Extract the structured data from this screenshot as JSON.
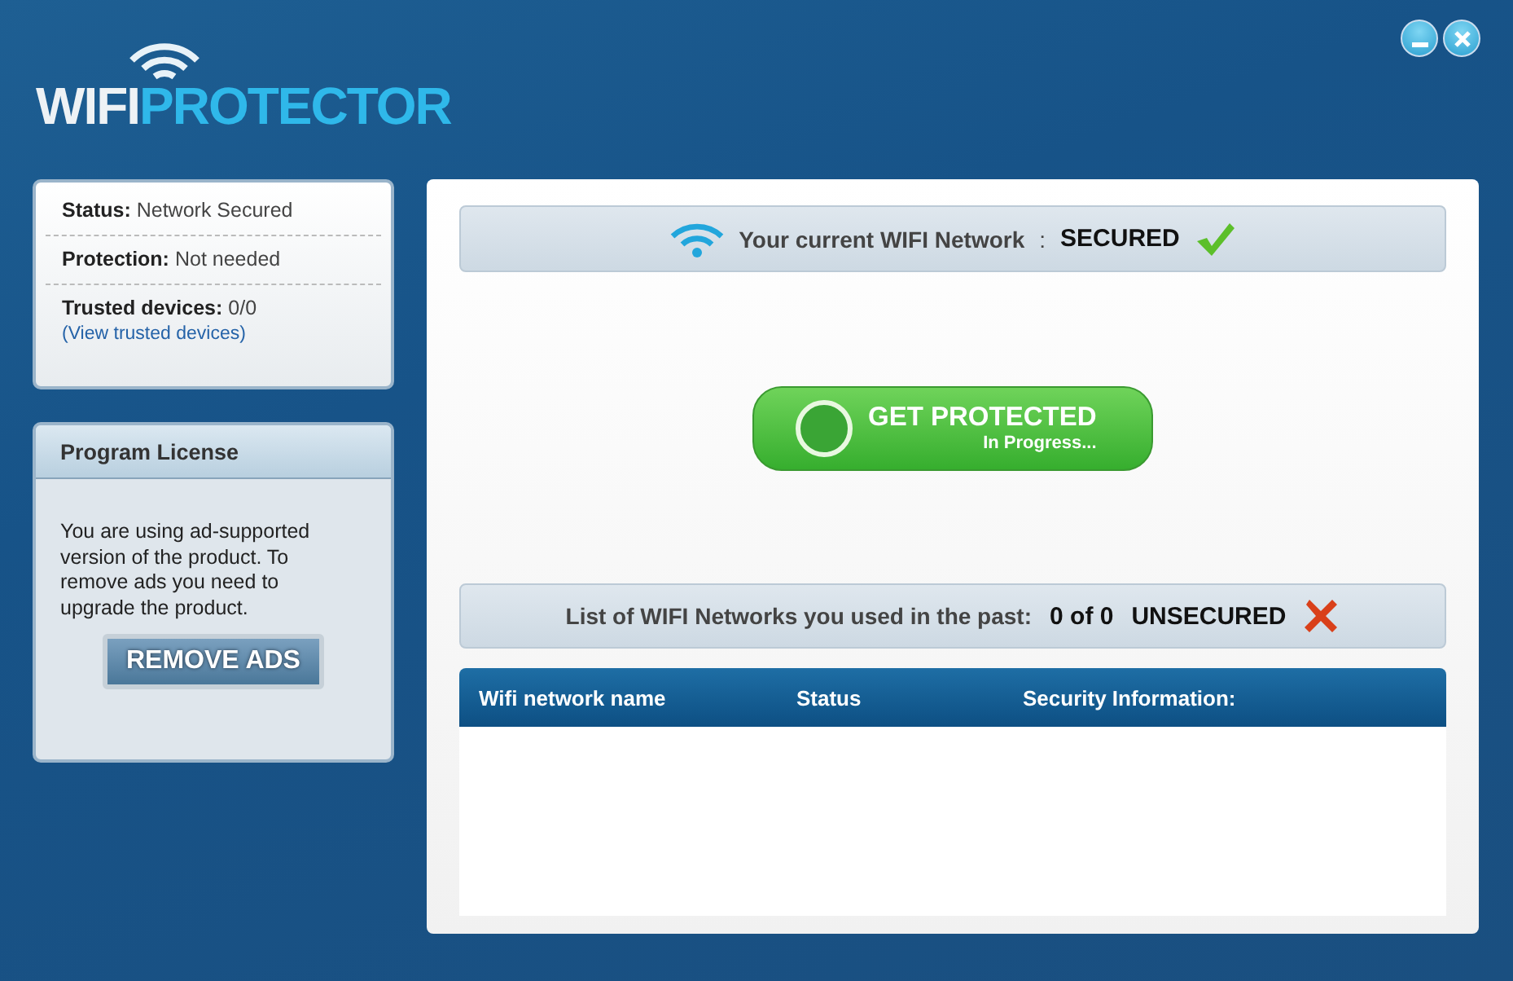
{
  "logo": {
    "first": "WIFI",
    "second": "PROTECTOR"
  },
  "window_controls": [
    {
      "kind": "minimize"
    },
    {
      "kind": "close"
    }
  ],
  "status_card": {
    "items": [
      {
        "label": "Status:",
        "value": "Network Secured"
      },
      {
        "label": "Protection:",
        "value": "Not needed"
      },
      {
        "label": "Trusted devices:",
        "value": "0/0",
        "link": "(View trusted devices)"
      }
    ]
  },
  "license_card": {
    "title": "Program License",
    "text": "You are using ad-supported version of the product. To remove ads you need to upgrade the product.",
    "button": "REMOVE ADS"
  },
  "current_network": {
    "label": "Your current WIFI Network",
    "separator": ":",
    "status": "SECURED",
    "kind": "secured"
  },
  "protect_button": {
    "label": "GET PROTECTED",
    "sublabel": "In Progress..."
  },
  "past_networks": {
    "label": "List of WIFI Networks you used in the past:",
    "count": "0 of 0",
    "status": "UNSECURED",
    "kind": "unsecured"
  },
  "table": {
    "columns": [
      "Wifi network name",
      "Status",
      "Security Information:"
    ]
  }
}
